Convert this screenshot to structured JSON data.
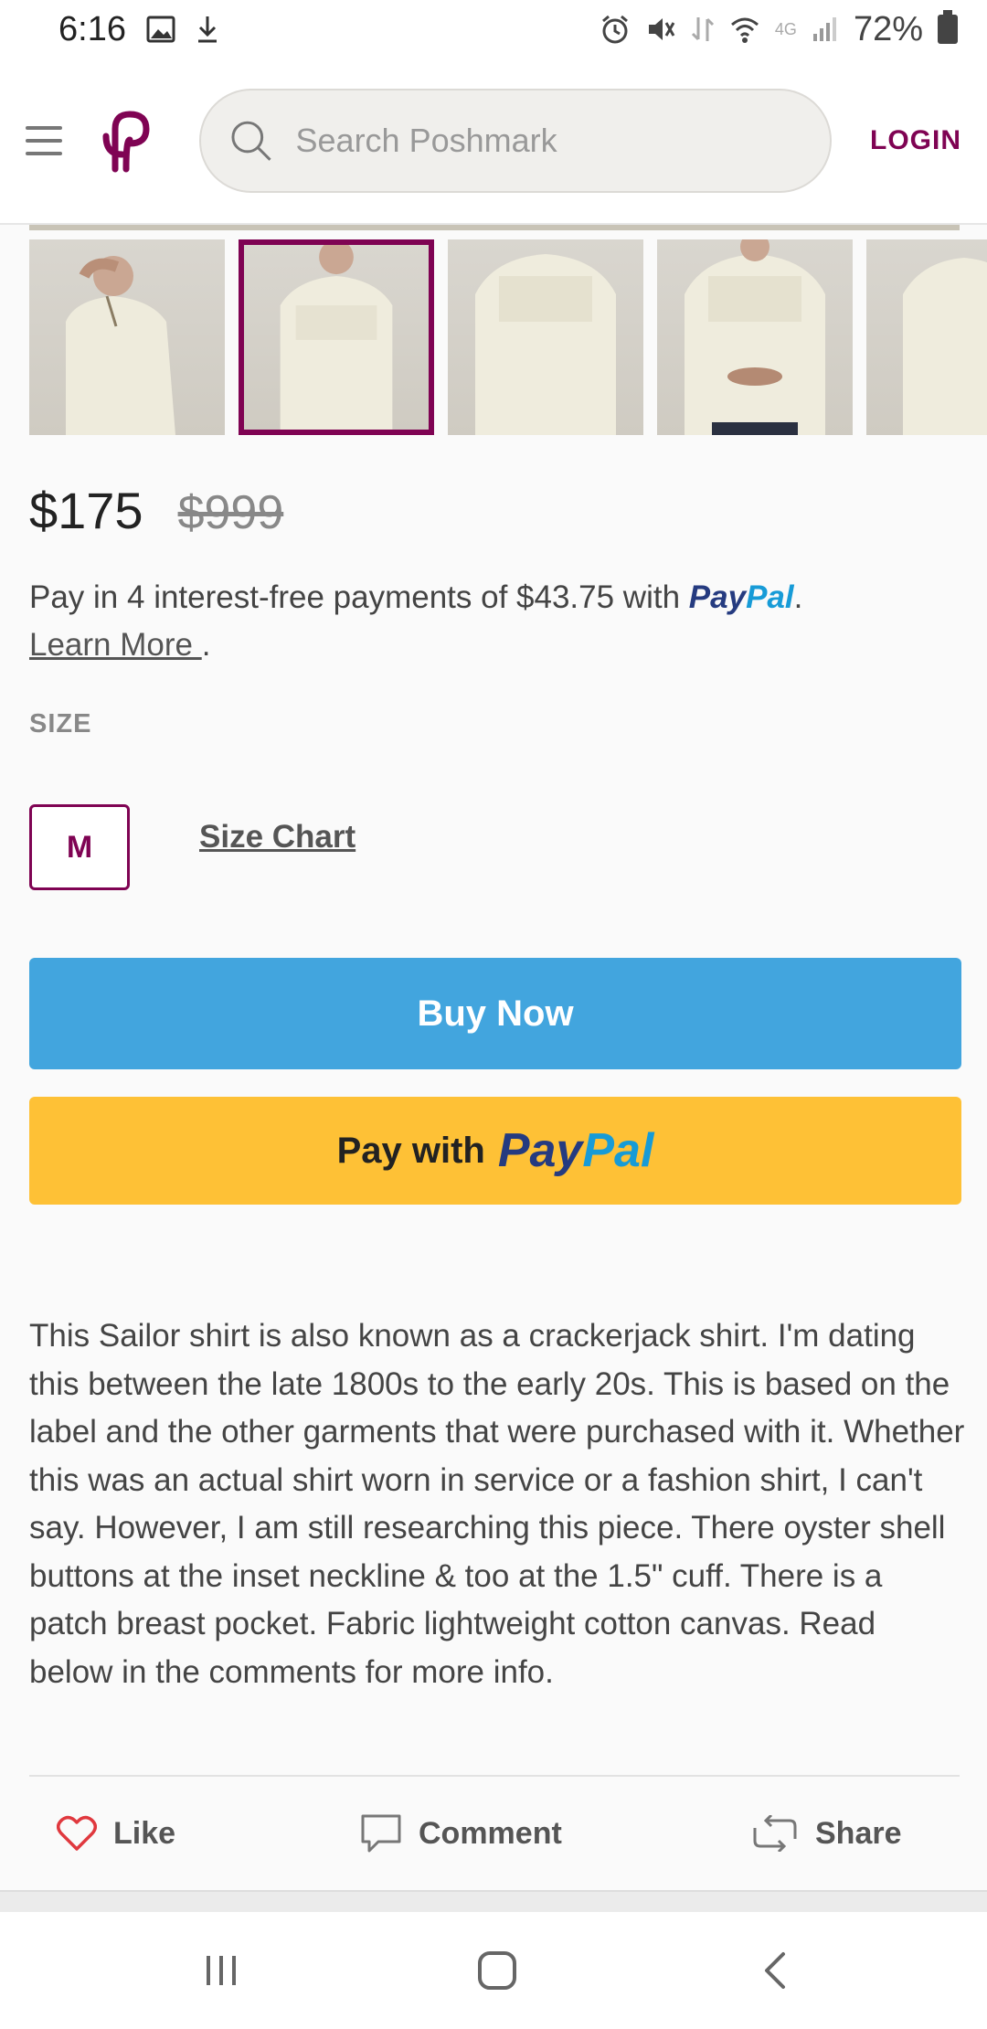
{
  "status_bar": {
    "time": "6:16",
    "battery": "72%",
    "network": "4G"
  },
  "header": {
    "search_placeholder": "Search Poshmark",
    "login_label": "LOGIN"
  },
  "thumbnails": [
    {
      "name": "thumb-1",
      "selected": false
    },
    {
      "name": "thumb-2",
      "selected": true
    },
    {
      "name": "thumb-3",
      "selected": false
    },
    {
      "name": "thumb-4",
      "selected": false
    },
    {
      "name": "thumb-5",
      "selected": false
    }
  ],
  "listing": {
    "price": "$175",
    "original_price": "$999",
    "paypal_line_prefix": "Pay in 4 interest-free payments of $43.75 with",
    "paypal_brand_dark": "Pay",
    "paypal_brand_light": "Pal",
    "period": ".",
    "learn_more": "Learn More ",
    "size_heading": "SIZE",
    "size_value": "M",
    "size_chart": "Size Chart",
    "buy_now": "Buy Now",
    "pay_with": "Pay with",
    "description": "This Sailor shirt is also known as a crackerjack shirt. I'm dating this between the late 1800s to the early 20s. This is based on the label and the other garments that were purchased with it. Whether this was an actual shirt worn in service or a fashion shirt, I can't say. However, I am still researching this piece. There oyster shell buttons at the inset neckline & too at the 1.5\" cuff. There is a patch breast pocket. Fabric lightweight cotton canvas. Read below in the comments for more info."
  },
  "actions": {
    "like": "Like",
    "comment": "Comment",
    "share": "Share"
  },
  "colors": {
    "brand": "#7f0353",
    "buy_now": "#42a5de",
    "paypal_button": "#fec136",
    "like_icon": "#e0383e"
  },
  "icons": {
    "menu": "hamburger-icon",
    "logo": "poshmark-logo-icon",
    "search": "search-icon",
    "like": "heart-icon",
    "comment": "comment-icon",
    "share": "share-icon"
  }
}
